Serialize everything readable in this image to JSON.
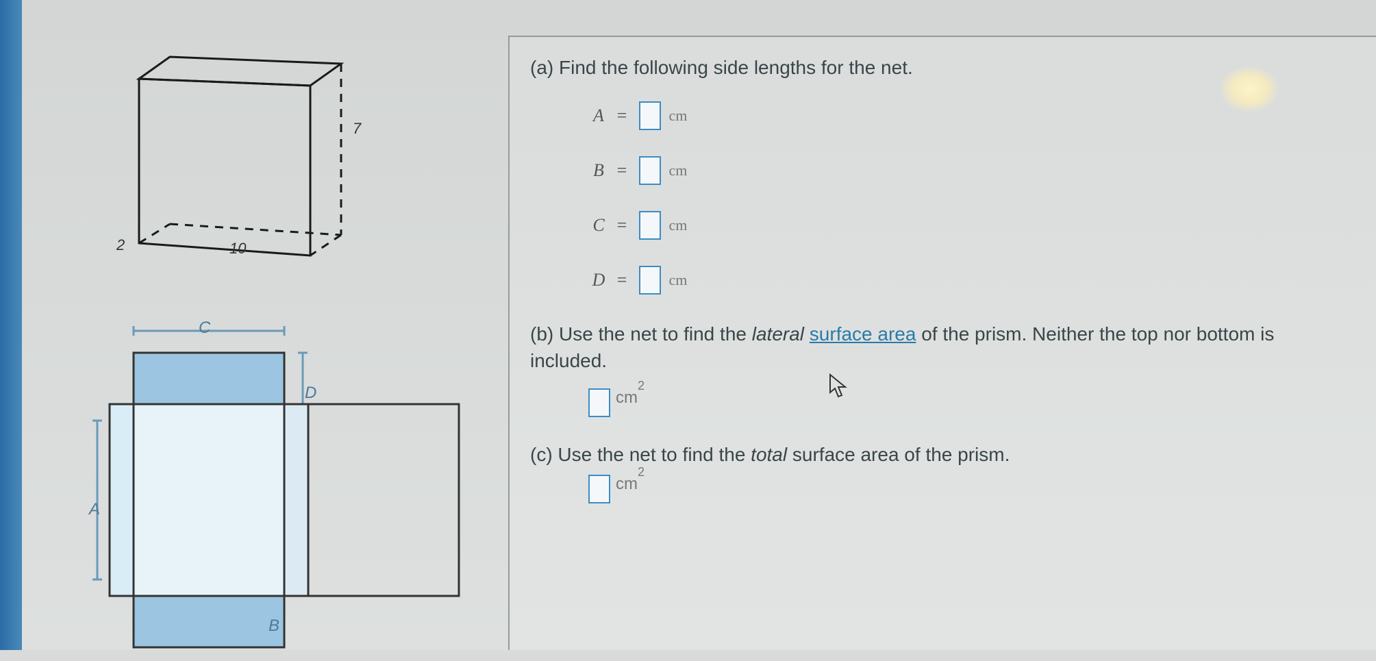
{
  "prism": {
    "dim_depth": "2",
    "dim_width": "10",
    "dim_height": "7"
  },
  "net": {
    "label_A": "A",
    "label_B": "B",
    "label_C": "C",
    "label_D": "D"
  },
  "question_a": {
    "prompt": "(a) Find the following side lengths for the net.",
    "rows": [
      {
        "var": "A",
        "unit": "cm"
      },
      {
        "var": "B",
        "unit": "cm"
      },
      {
        "var": "C",
        "unit": "cm"
      },
      {
        "var": "D",
        "unit": "cm"
      }
    ]
  },
  "question_b": {
    "prompt_1": "(b) Use the net to find the ",
    "prompt_italic": "lateral",
    "prompt_link": "surface area",
    "prompt_2": " of the prism. Neither the top nor bottom is included.",
    "unit": "cm",
    "exp": "2"
  },
  "question_c": {
    "prompt_1": "(c) Use the net to find the ",
    "prompt_italic": "total",
    "prompt_2": " surface area of the prism.",
    "unit": "cm",
    "exp": "2"
  },
  "equals": "="
}
